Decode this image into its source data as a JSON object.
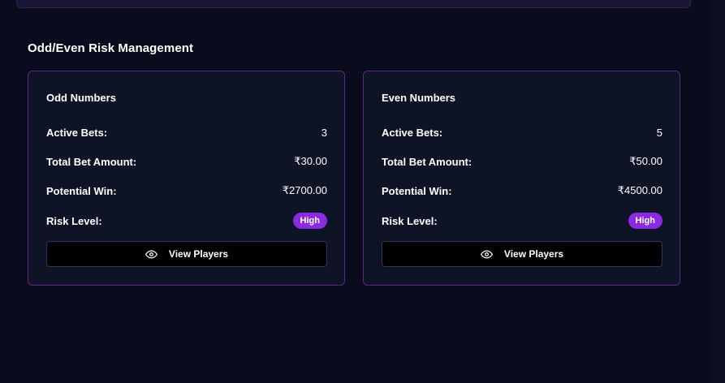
{
  "section": {
    "title": "Odd/Even Risk Management"
  },
  "cards": [
    {
      "title": "Odd Numbers",
      "active_bets_label": "Active Bets:",
      "active_bets": "3",
      "total_bet_label": "Total Bet Amount:",
      "total_bet": "₹30.00",
      "potential_win_label": "Potential Win:",
      "potential_win": "₹2700.00",
      "risk_label": "Risk Level:",
      "risk_level": "High",
      "button_label": "View Players",
      "button_icon": "eye-icon"
    },
    {
      "title": "Even Numbers",
      "active_bets_label": "Active Bets:",
      "active_bets": "5",
      "total_bet_label": "Total Bet Amount:",
      "total_bet": "₹50.00",
      "potential_win_label": "Potential Win:",
      "potential_win": "₹4500.00",
      "risk_label": "Risk Level:",
      "risk_level": "High",
      "button_label": "View Players",
      "button_icon": "eye-icon"
    }
  ],
  "colors": {
    "background": "#0b0b1e",
    "card_background": "#0e1326",
    "card_border": "#5b2a86",
    "badge_high": "#8a2be2",
    "button_background": "#000000"
  }
}
